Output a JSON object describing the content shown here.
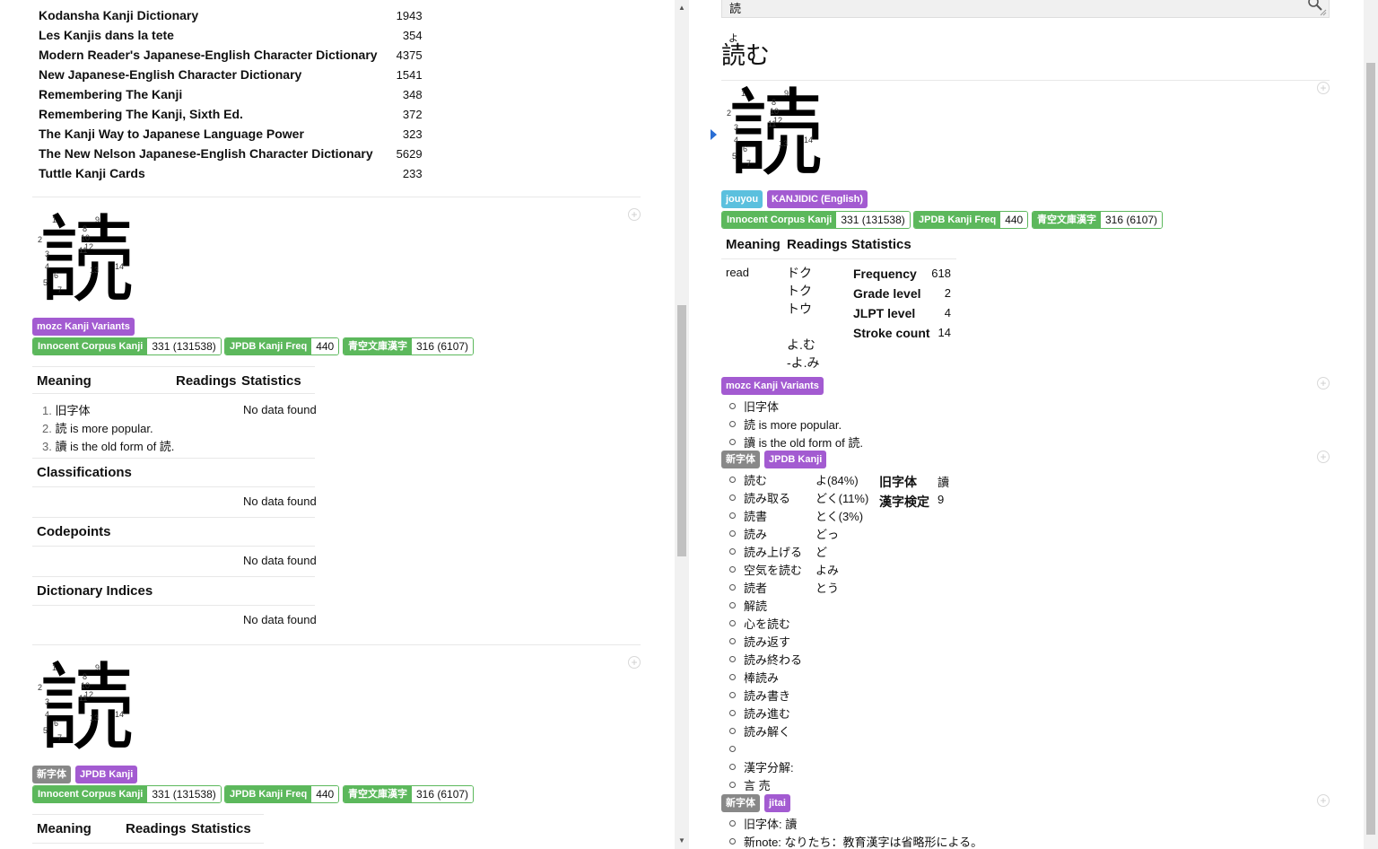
{
  "left": {
    "dict_table": [
      {
        "name": "Kodansha Kanji Dictionary",
        "num": "1943"
      },
      {
        "name": "Les Kanjis dans la tete",
        "num": "354"
      },
      {
        "name": "Modern Reader's Japanese-English Character Dictionary",
        "num": "4375"
      },
      {
        "name": "New Japanese-English Character Dictionary",
        "num": "1541"
      },
      {
        "name": "Remembering The Kanji",
        "num": "348"
      },
      {
        "name": "Remembering The Kanji, Sixth Ed.",
        "num": "372"
      },
      {
        "name": "The Kanji Way to Japanese Language Power",
        "num": "323"
      },
      {
        "name": "The New Nelson Japanese-English Character Dictionary",
        "num": "5629"
      },
      {
        "name": "Tuttle Kanji Cards",
        "num": "233"
      }
    ],
    "entry1": {
      "kanji": "読",
      "stroke_numbers": [
        "1",
        "2",
        "3",
        "4",
        "5",
        "6",
        "7",
        "8",
        "9",
        "10",
        "11",
        "12",
        "13",
        "14"
      ],
      "tags": [
        "mozc Kanji Variants"
      ],
      "freq": [
        {
          "k": "Innocent Corpus Kanji",
          "v": "331 (131538)"
        },
        {
          "k": "JPDB Kanji Freq",
          "v": "440"
        },
        {
          "k": "青空文庫漢字",
          "v": "316 (6107)"
        }
      ],
      "headers": {
        "meaning": "Meaning",
        "readings": "Readings",
        "statistics": "Statistics"
      },
      "meanings": [
        {
          "n": "1.",
          "t": "旧字体"
        },
        {
          "n": "2.",
          "t": "読 is more popular."
        },
        {
          "n": "3.",
          "t": "讀 is the old form of 読."
        }
      ],
      "no_data": "No data found",
      "sections": [
        "Classifications",
        "Codepoints",
        "Dictionary Indices"
      ]
    },
    "entry2": {
      "kanji": "読",
      "tags": [
        "新字体",
        "JPDB Kanji"
      ],
      "freq": [
        {
          "k": "Innocent Corpus Kanji",
          "v": "331 (131538)"
        },
        {
          "k": "JPDB Kanji Freq",
          "v": "440"
        },
        {
          "k": "青空文庫漢字",
          "v": "316 (6107)"
        }
      ],
      "headers": {
        "meaning": "Meaning",
        "readings": "Readings",
        "statistics": "Statistics"
      }
    }
  },
  "right": {
    "search_value": "読",
    "term": {
      "furigana": "よ",
      "word": "読む"
    },
    "kanji": "読",
    "tags": [
      "jouyou",
      "KANJIDIC (English)"
    ],
    "freq": [
      {
        "k": "Innocent Corpus Kanji",
        "v": "331 (131538)"
      },
      {
        "k": "JPDB Kanji Freq",
        "v": "440"
      },
      {
        "k": "青空文庫漢字",
        "v": "316 (6107)"
      }
    ],
    "headers": {
      "meaning": "Meaning",
      "readings": "Readings",
      "statistics": "Statistics"
    },
    "meaning": "read",
    "readings": [
      "ドク",
      "トク",
      "トウ",
      "",
      "よ.む",
      "-よ.み"
    ],
    "stats": [
      {
        "k": "Frequency",
        "v": "618"
      },
      {
        "k": "Grade level",
        "v": "2"
      },
      {
        "k": "JLPT level",
        "v": "4"
      },
      {
        "k": "Stroke count",
        "v": "14"
      }
    ],
    "mozc": {
      "tag": "mozc Kanji Variants",
      "items": [
        "旧字体",
        "読 is more popular.",
        "讀 is the old form of 読."
      ]
    },
    "jpdb": {
      "tags": [
        "新字体",
        "JPDB Kanji"
      ],
      "words": [
        "読む",
        "読み取る",
        "読書",
        "読み",
        "読み上げる",
        "空気を読む",
        "読者",
        "解読",
        "心を読む",
        "読み返す",
        "読み終わる",
        "棒読み",
        "読み書き",
        "読み進む",
        "読み解く",
        "",
        "漢字分解:",
        "言 売"
      ],
      "readings": [
        "よ(84%)",
        "どく(11%)",
        "とく(3%)",
        "どっ",
        "ど",
        "よみ",
        "とう"
      ],
      "stats": [
        {
          "k": "旧字体",
          "v": "讀"
        },
        {
          "k": "漢字検定",
          "v": "9"
        }
      ]
    },
    "jitai": {
      "tags": [
        "新字体",
        "jitai"
      ],
      "items": [
        "旧字体: 讀",
        "新note: なりたち：教育漢字は省略形による。"
      ]
    }
  }
}
